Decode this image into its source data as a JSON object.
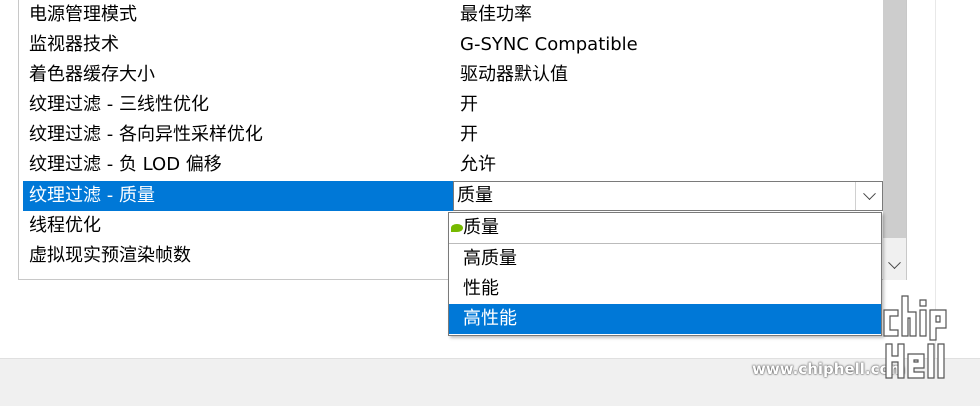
{
  "settings": {
    "rows": [
      {
        "name": "电源管理模式",
        "value": "最佳功率"
      },
      {
        "name": "监视器技术",
        "value": "G-SYNC Compatible"
      },
      {
        "name": "着色器缓存大小",
        "value": "驱动器默认值"
      },
      {
        "name": "纹理过滤 - 三线性优化",
        "value": "开"
      },
      {
        "name": "纹理过滤 - 各向异性采样优化",
        "value": "开"
      },
      {
        "name": "纹理过滤 - 负 LOD 偏移",
        "value": "允许"
      },
      {
        "name": "纹理过滤 - 质量",
        "value": "质量"
      },
      {
        "name": "线程优化",
        "value": ""
      },
      {
        "name": "虚拟现实预渲染帧数",
        "value": ""
      }
    ]
  },
  "dropdown": {
    "options": [
      "质量",
      "高质量",
      "性能",
      "高性能"
    ],
    "highlighted": "高性能"
  },
  "watermark": {
    "url": "www.chiphell.com"
  },
  "colors": {
    "selection": "#0078d7",
    "nvidia_green": "#76b900"
  }
}
